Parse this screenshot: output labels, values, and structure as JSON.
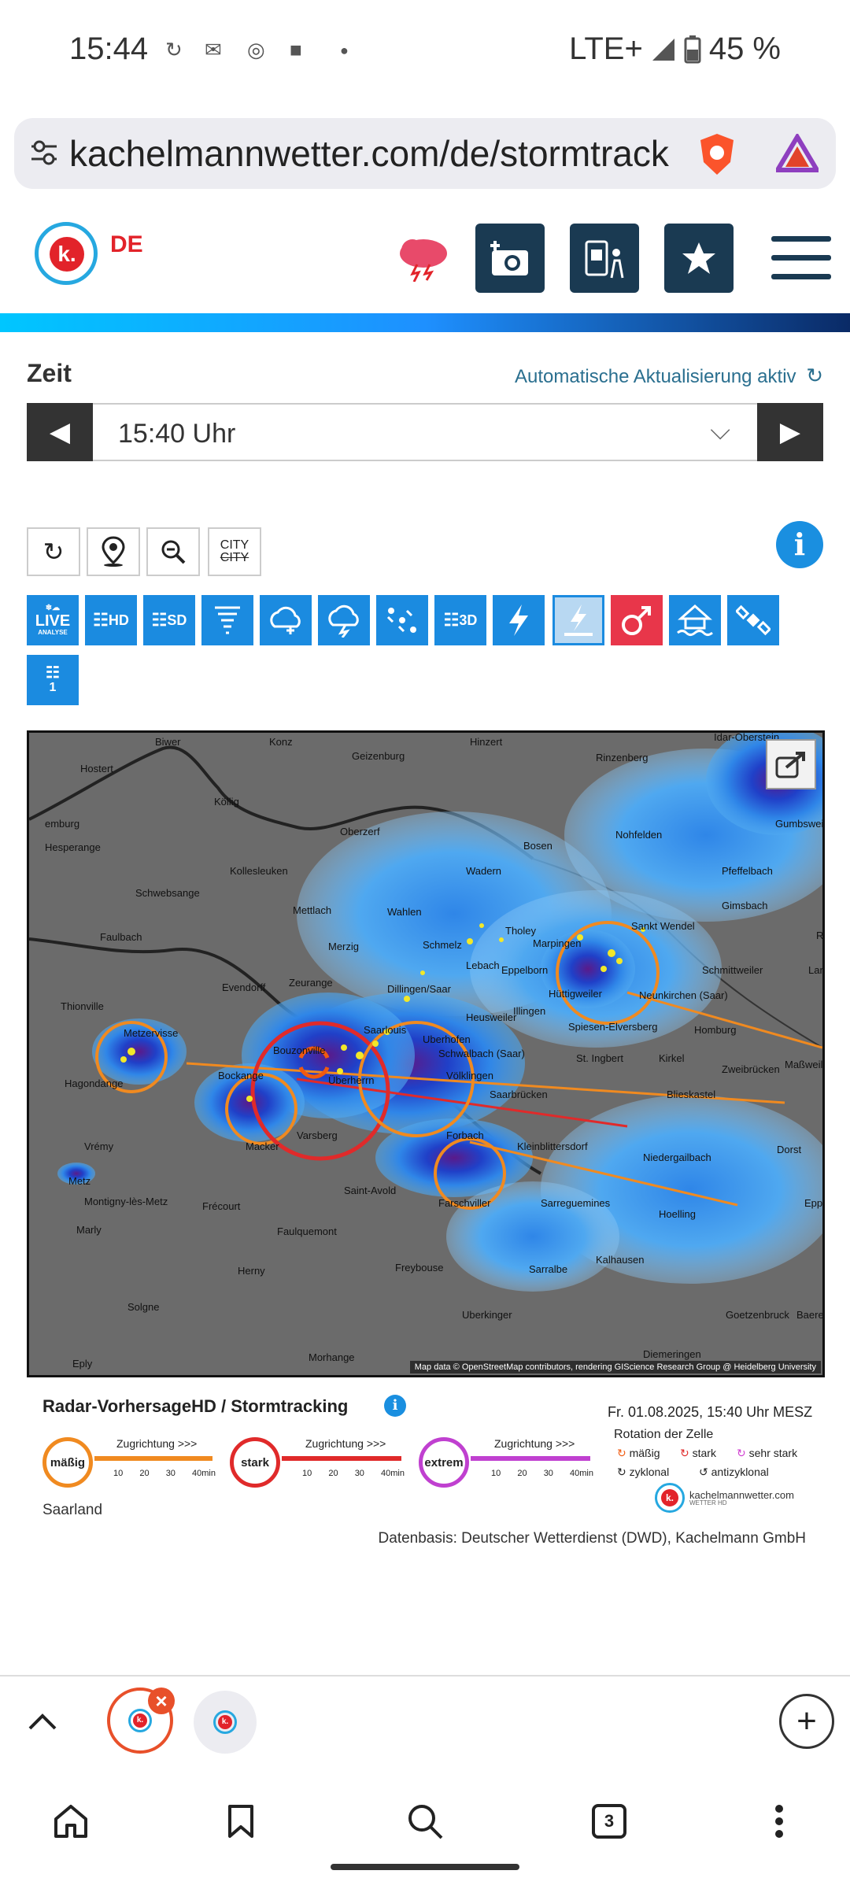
{
  "status_bar": {
    "time": "15:44",
    "network": "LTE+",
    "battery": "45 %"
  },
  "url_bar": {
    "url": "kachelmannwetter.com/de/stormtrack"
  },
  "site_header": {
    "country": "DE",
    "logo_letter": "k."
  },
  "zeit": {
    "label": "Zeit",
    "auto_update": "Automatische Aktualisierung aktiv",
    "selected_time": "15:40 Uhr"
  },
  "tools": {
    "city_label": "CITY",
    "city_label_struck": "CITY"
  },
  "layers": [
    {
      "label": "LIVE",
      "sub": "ANALYSE"
    },
    {
      "label": "HD"
    },
    {
      "label": "SD"
    },
    {
      "label": "tornado"
    },
    {
      "label": "rain"
    },
    {
      "label": "storm"
    },
    {
      "label": "hail"
    },
    {
      "label": "3D"
    },
    {
      "label": "lightning"
    },
    {
      "label": "lightning-active"
    },
    {
      "label": "gender"
    },
    {
      "label": "flood"
    },
    {
      "label": "satellite"
    },
    {
      "label": "1"
    }
  ],
  "map": {
    "attribution": "Map data © OpenStreetMap contributors, rendering GIScience Research Group @ Heidelberg University",
    "places": [
      {
        "name": "Biwer"
      },
      {
        "name": "Konz"
      },
      {
        "name": "Hinzert"
      },
      {
        "name": "Idar-Oberstein"
      },
      {
        "name": "Hostert"
      },
      {
        "name": "Geizenburg"
      },
      {
        "name": "Rinzenberg"
      },
      {
        "name": "Köllig"
      },
      {
        "name": "emburg"
      },
      {
        "name": "Oberzerf"
      },
      {
        "name": "Nohfelden"
      },
      {
        "name": "Gumbsweiler"
      },
      {
        "name": "Hesperange"
      },
      {
        "name": "Bosen"
      },
      {
        "name": "Kollesleuken"
      },
      {
        "name": "Wadern"
      },
      {
        "name": "Pfeffelbach"
      },
      {
        "name": "Schwebsange"
      },
      {
        "name": "Mettlach"
      },
      {
        "name": "Wahlen"
      },
      {
        "name": "Gimsbach"
      },
      {
        "name": "Tholey"
      },
      {
        "name": "Sankt Wendel"
      },
      {
        "name": "Ramstein-Miesenbach"
      },
      {
        "name": "Faulbach"
      },
      {
        "name": "Merzig"
      },
      {
        "name": "Schmelz"
      },
      {
        "name": "Marpingen"
      },
      {
        "name": "Lebach"
      },
      {
        "name": "Eppelborn"
      },
      {
        "name": "Schmittweiler"
      },
      {
        "name": "Landstuhl"
      },
      {
        "name": "Evendorff"
      },
      {
        "name": "Zeurange"
      },
      {
        "name": "Thionville"
      },
      {
        "name": "Dillingen/Saar"
      },
      {
        "name": "Hüttigweiler"
      },
      {
        "name": "Illingen"
      },
      {
        "name": "Neunkirchen (Saar)"
      },
      {
        "name": "Heusweiler"
      },
      {
        "name": "Metzervisse"
      },
      {
        "name": "Saarlouis"
      },
      {
        "name": "Spiesen-Elversberg"
      },
      {
        "name": "Homburg"
      },
      {
        "name": "Bouzonville"
      },
      {
        "name": "Uberhofen"
      },
      {
        "name": "Schwalbach (Saar)"
      },
      {
        "name": "St. Ingbert"
      },
      {
        "name": "Kirkel"
      },
      {
        "name": "Maßweiler"
      },
      {
        "name": "Hagondange"
      },
      {
        "name": "Bockange"
      },
      {
        "name": "Völklingen"
      },
      {
        "name": "Zweibrücken"
      },
      {
        "name": "Überherrn"
      },
      {
        "name": "Saarbrücken"
      },
      {
        "name": "Blieskastel"
      },
      {
        "name": "Vrémy"
      },
      {
        "name": "Macker"
      },
      {
        "name": "Varsberg"
      },
      {
        "name": "Forbach"
      },
      {
        "name": "Kleinblittersdorf"
      },
      {
        "name": "Dorst"
      },
      {
        "name": "Niedergailbach"
      },
      {
        "name": "Metz"
      },
      {
        "name": "Saint-Avold"
      },
      {
        "name": "Farschviller"
      },
      {
        "name": "Sarreguemines"
      },
      {
        "name": "Eppenbrunn"
      },
      {
        "name": "Montigny-lès-Metz"
      },
      {
        "name": "Frécourt"
      },
      {
        "name": "Hoelling"
      },
      {
        "name": "Marly"
      },
      {
        "name": "Faulquemont"
      },
      {
        "name": "Kalhausen"
      },
      {
        "name": "Herny"
      },
      {
        "name": "Freybouse"
      },
      {
        "name": "Sarralbe"
      },
      {
        "name": "Solgne"
      },
      {
        "name": "Uberkinger"
      },
      {
        "name": "Goetzenbruck"
      },
      {
        "name": "Baerenthal"
      },
      {
        "name": "Diemeringen"
      },
      {
        "name": "Morhange"
      },
      {
        "name": "Eply"
      }
    ]
  },
  "legend": {
    "title": "Radar-VorhersageHD / Stormtracking",
    "date": "Fr. 01.08.2025, 15:40 Uhr MESZ",
    "direction": "Zugrichtung >>>",
    "ticks": [
      "10",
      "20",
      "30",
      "40min"
    ],
    "levels": [
      {
        "name": "mäßig",
        "color": "#f08a20"
      },
      {
        "name": "stark",
        "color": "#e02a2a"
      },
      {
        "name": "extrem",
        "color": "#c040d0"
      }
    ],
    "rotation_label": "Rotation der Zelle",
    "rotation": [
      "mäßig",
      "stark",
      "sehr stark",
      "zyklonal",
      "antizyklonal"
    ],
    "brand": "kachelmannwetter.com",
    "brand_sub": "WETTER HD",
    "region": "Saarland",
    "source": "Datenbasis: Deutscher Wetterdienst (DWD), Kachelmann GmbH"
  },
  "tabs": {
    "count": "3"
  }
}
